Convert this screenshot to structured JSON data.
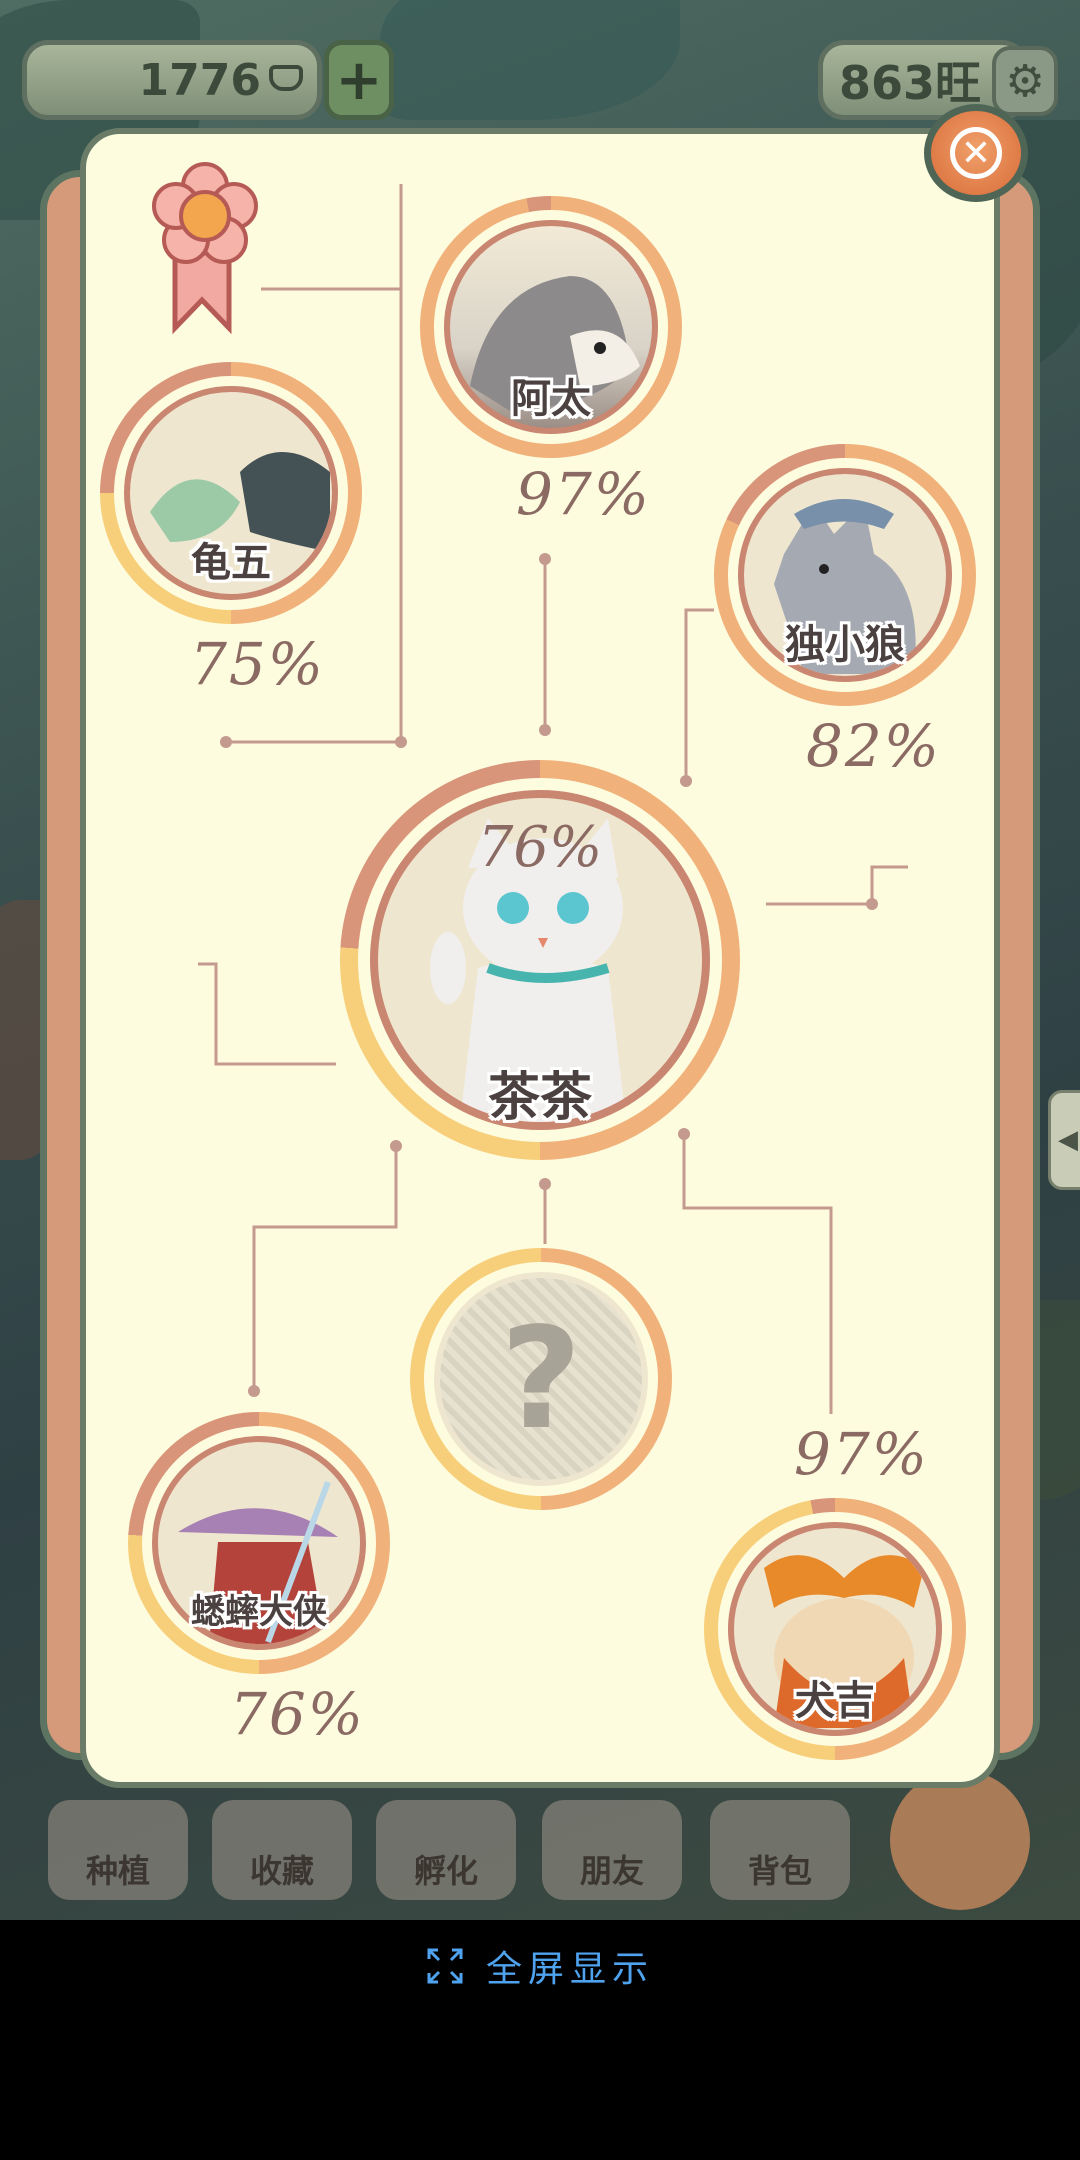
{
  "top_bar": {
    "coins": "1776",
    "energy": "863旺"
  },
  "relationship_panel": {
    "center": {
      "name": "茶茶",
      "percent": "76%"
    },
    "characters": [
      {
        "name": "阿太",
        "percent": "97%"
      },
      {
        "name": "龟五",
        "percent": "75%"
      },
      {
        "name": "独小狼",
        "percent": "82%"
      },
      {
        "name": "?",
        "percent": ""
      },
      {
        "name": "蟋蟀大侠",
        "percent": "76%"
      },
      {
        "name": "犬吉",
        "percent": "97%"
      }
    ]
  },
  "bottom_nav": {
    "items": [
      {
        "label": "种植"
      },
      {
        "label": "收藏"
      },
      {
        "label": "孵化"
      },
      {
        "label": "朋友"
      },
      {
        "label": "背包"
      }
    ]
  },
  "fullscreen_caption": "全屏显示",
  "colors": {
    "panel_bg": "#fefcdf",
    "ring_outer": "#f0b27a",
    "ring_light": "#f7cf7a",
    "ring_dark": "#d9957a",
    "percent_text": "#8a6a62",
    "caption_blue": "#4fa3ee"
  }
}
